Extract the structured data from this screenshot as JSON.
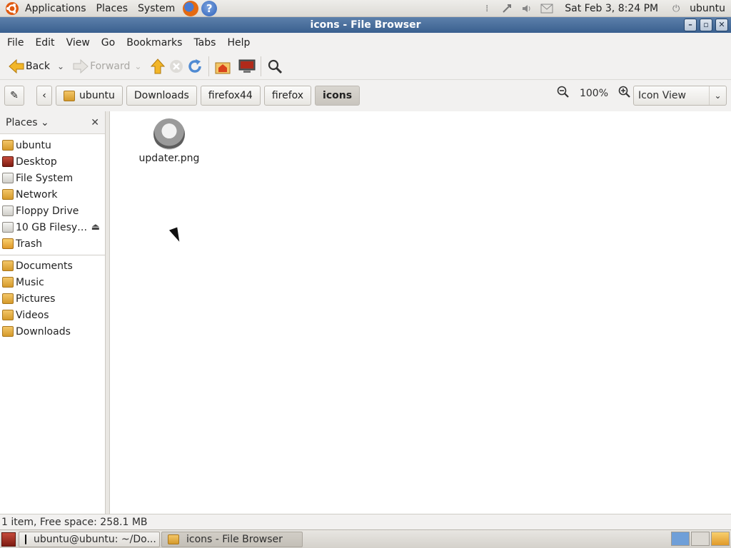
{
  "panel": {
    "menus": [
      "Applications",
      "Places",
      "System"
    ],
    "clock": "Sat Feb  3,  8:24 PM",
    "user": "ubuntu"
  },
  "window": {
    "title": "icons - File Browser"
  },
  "menubar": [
    "File",
    "Edit",
    "View",
    "Go",
    "Bookmarks",
    "Tabs",
    "Help"
  ],
  "toolbar": {
    "back": "Back",
    "forward": "Forward"
  },
  "pathbar": {
    "crumbs": [
      "ubuntu",
      "Downloads",
      "firefox44",
      "firefox",
      "icons"
    ],
    "zoom": "100%",
    "view": "Icon View"
  },
  "sidebar": {
    "title": "Places",
    "devices": [
      "ubuntu",
      "Desktop",
      "File System",
      "Network",
      "Floppy Drive",
      "10 GB Filesy…",
      "Trash"
    ],
    "bookmarks": [
      "Documents",
      "Music",
      "Pictures",
      "Videos",
      "Downloads"
    ]
  },
  "content": {
    "files": [
      {
        "name": "updater.png"
      }
    ]
  },
  "status": "1 item, Free space: 258.1 MB",
  "taskbar": [
    "ubuntu@ubuntu: ~/Do...",
    "icons - File Browser"
  ],
  "colors": {
    "titlebar": "#3a608f",
    "folder": "#f3c668"
  }
}
